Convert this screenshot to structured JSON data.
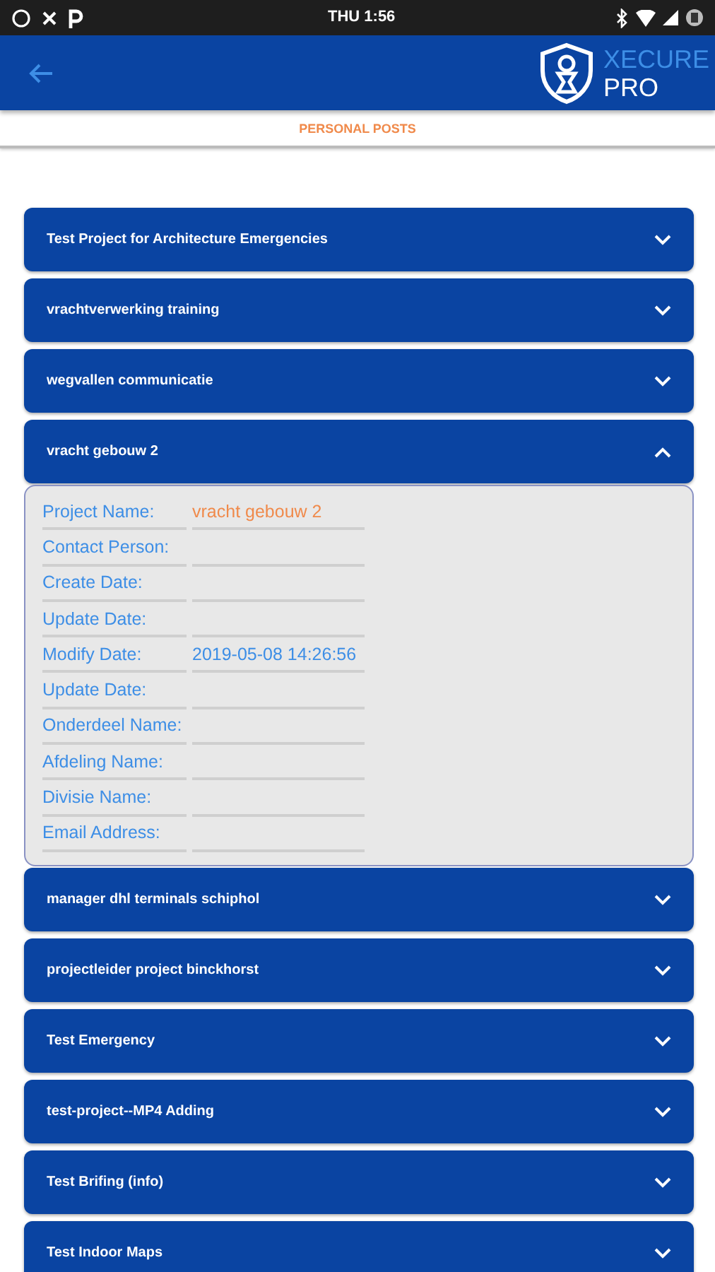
{
  "status_bar": {
    "time": "THU 1:56"
  },
  "header": {
    "logo_line1": "XECURE",
    "logo_line2": "PRO"
  },
  "tabs": [
    {
      "label": "PERSONAL POSTS",
      "selected": true
    }
  ],
  "posts": [
    {
      "title": "Test Project for Architecture Emergencies",
      "expanded": false
    },
    {
      "title": "vrachtverwerking training",
      "expanded": false
    },
    {
      "title": "wegvallen communicatie",
      "expanded": false
    },
    {
      "title": "vracht gebouw 2",
      "expanded": true,
      "details": [
        {
          "label": "Project Name:",
          "value": "vracht gebouw 2",
          "color": "#f08a4b"
        },
        {
          "label": "Contact Person:"
        },
        {
          "label": "Create Date:"
        },
        {
          "label": "Update Date:"
        },
        {
          "label": "Modify Date:",
          "value": "2019-05-08 14:26:56",
          "color": "#3d8ee6"
        },
        {
          "label": "Update Date:"
        },
        {
          "label": "Onderdeel Name:"
        },
        {
          "label": "Afdeling Name:"
        },
        {
          "label": "Divisie Name:"
        },
        {
          "label": "Email Address:"
        }
      ]
    },
    {
      "title": "manager dhl terminals schiphol",
      "expanded": false
    },
    {
      "title": "projectleider project binckhorst",
      "expanded": false
    },
    {
      "title": "Test Emergency",
      "expanded": false
    },
    {
      "title": "test-project--MP4 Adding",
      "expanded": false
    },
    {
      "title": "Test Brifing (info)",
      "expanded": false
    },
    {
      "title": "Test Indoor Maps",
      "expanded": false
    }
  ]
}
